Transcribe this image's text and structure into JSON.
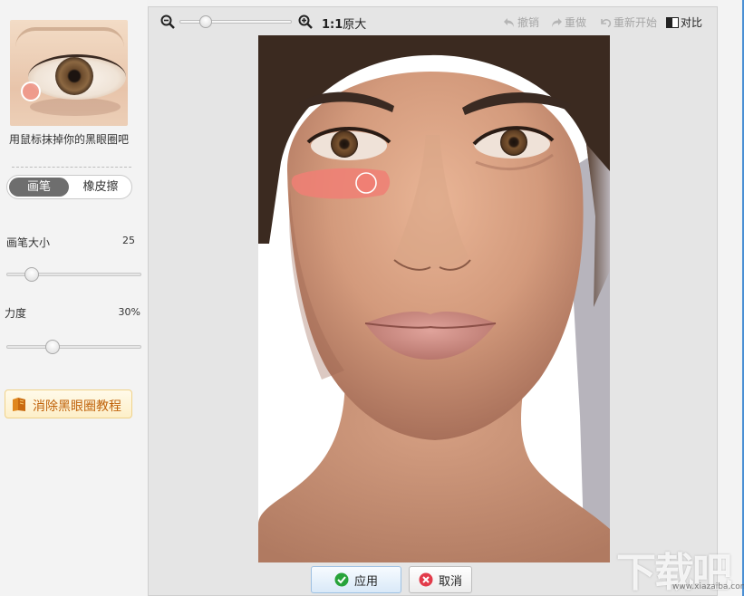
{
  "left_panel": {
    "hint": "用鼠标抹掉你的黑眼圈吧",
    "tool_toggle": {
      "brush": "画笔",
      "eraser": "橡皮擦",
      "active": "brush"
    },
    "brush_size": {
      "label": "画笔大小",
      "value": "25",
      "level": 0.15
    },
    "strength": {
      "label": "力度",
      "value": "30%",
      "level": 0.32
    },
    "tutorial_button": "消除黑眼圈教程"
  },
  "toolbar": {
    "zoom_level": 0.2,
    "original_size_prefix": "1:1",
    "original_size_label": "原大",
    "undo": "撤销",
    "redo": "重做",
    "restart": "重新开始",
    "compare": "对比"
  },
  "actions": {
    "apply": "应用",
    "cancel": "取消"
  },
  "colors": {
    "apply_icon": "#27a33a",
    "cancel_icon": "#e23b4a",
    "brush_mark": "#f07f74",
    "accent_line": "#4a8fd4"
  },
  "watermark": {
    "big": "下载吧",
    "small": "www.xiazaiba.com"
  }
}
